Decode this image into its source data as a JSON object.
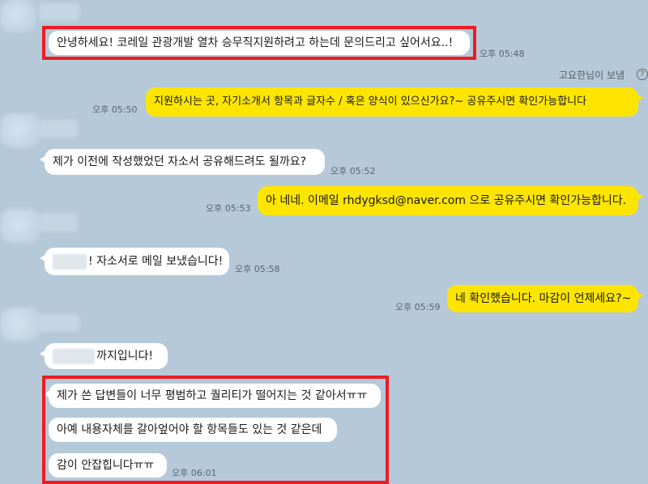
{
  "messages": [
    {
      "text": "안녕하세요! 코레일 관광개발 열차 승무직지원하려고 하는데 문의드리고 싶어서요..!",
      "time": "오후 05:48"
    },
    {
      "text": "지원하시는 곳, 자기소개서 항목과 글자수 / 혹은 양식이 있으신가요?~ 공유주시면 확인가능합니다",
      "time": "오후 05:50"
    },
    {
      "text": "제가 이전에 작성했었던 자소서 공유해드려도 될까요?",
      "time": "오후 05:52"
    },
    {
      "text": "아 네네. 이메일 rhdygksd@naver.com 으로 공유주시면 확인가능합니다.",
      "time": "오후 05:53"
    },
    {
      "text": "! 자소서로 메일 보냈습니다!",
      "time": "오후 05:58"
    },
    {
      "text": "네 확인했습니다. 마감이 언제세요?~",
      "time": "오후 05:59"
    },
    {
      "text": "까지입니다!"
    },
    {
      "text": "제가 쓴 답변들이 너무 평범하고 퀄리티가 떨어지는 것 같아서ㅠㅠ"
    },
    {
      "text": "아예 내용자체를 갈아엎어야 할 항목들도 있는 것 같은데"
    },
    {
      "text": "감이 안잡힙니다ㅠㅠ",
      "time": "오후 06:01"
    }
  ],
  "sender_note": "고요한님이 보냄",
  "help_icon_glyph": "?",
  "colors": {
    "background": "#b5c9d8",
    "incoming": "#ffffff",
    "outgoing": "#fee500",
    "highlight": "#ec1c24"
  }
}
